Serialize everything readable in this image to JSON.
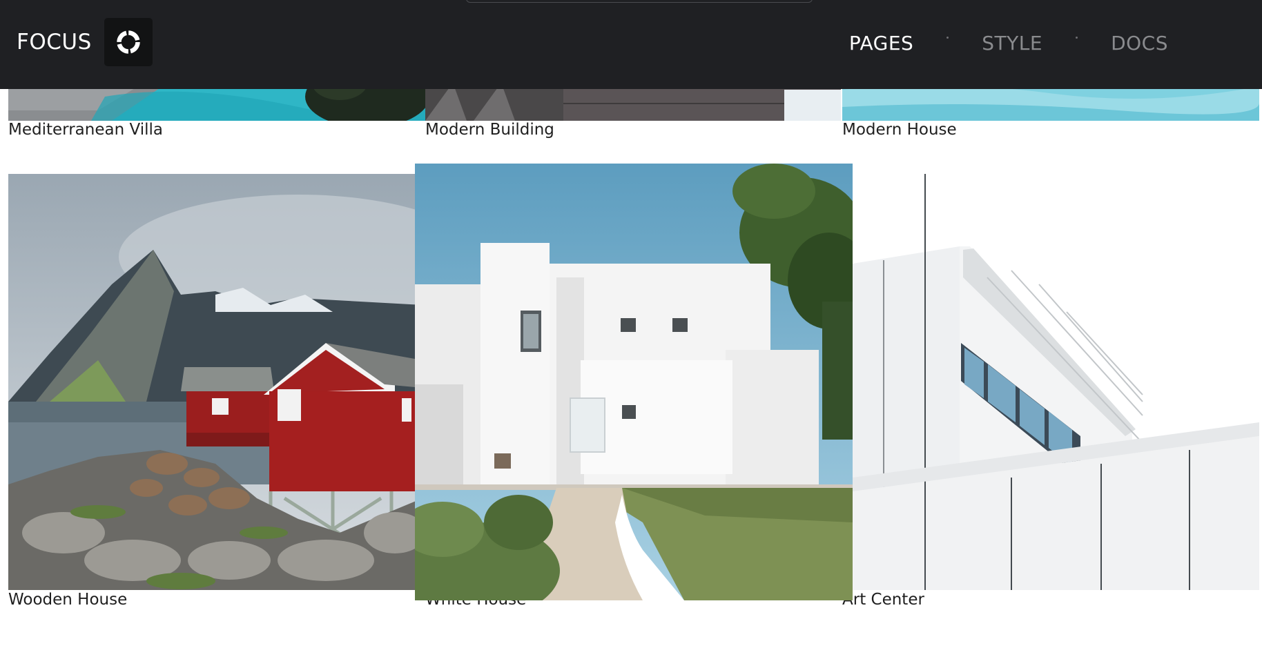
{
  "header": {
    "brand": "FOCUS",
    "logo_icon": "focus-ring-icon",
    "nav": [
      {
        "label": "PAGES",
        "active": true
      },
      {
        "label": "STYLE",
        "active": false
      },
      {
        "label": "DOCS",
        "active": false
      }
    ]
  },
  "gallery": {
    "items": [
      {
        "title": "Mediterranean Villa"
      },
      {
        "title": "Modern Building"
      },
      {
        "title": "Modern House"
      },
      {
        "title": "Wooden House"
      },
      {
        "title": "White House"
      },
      {
        "title": "Art Center"
      }
    ]
  },
  "colors": {
    "header_bg": "#1f2023",
    "nav_active": "#ffffff",
    "nav_inactive": "#8a8b8e"
  }
}
